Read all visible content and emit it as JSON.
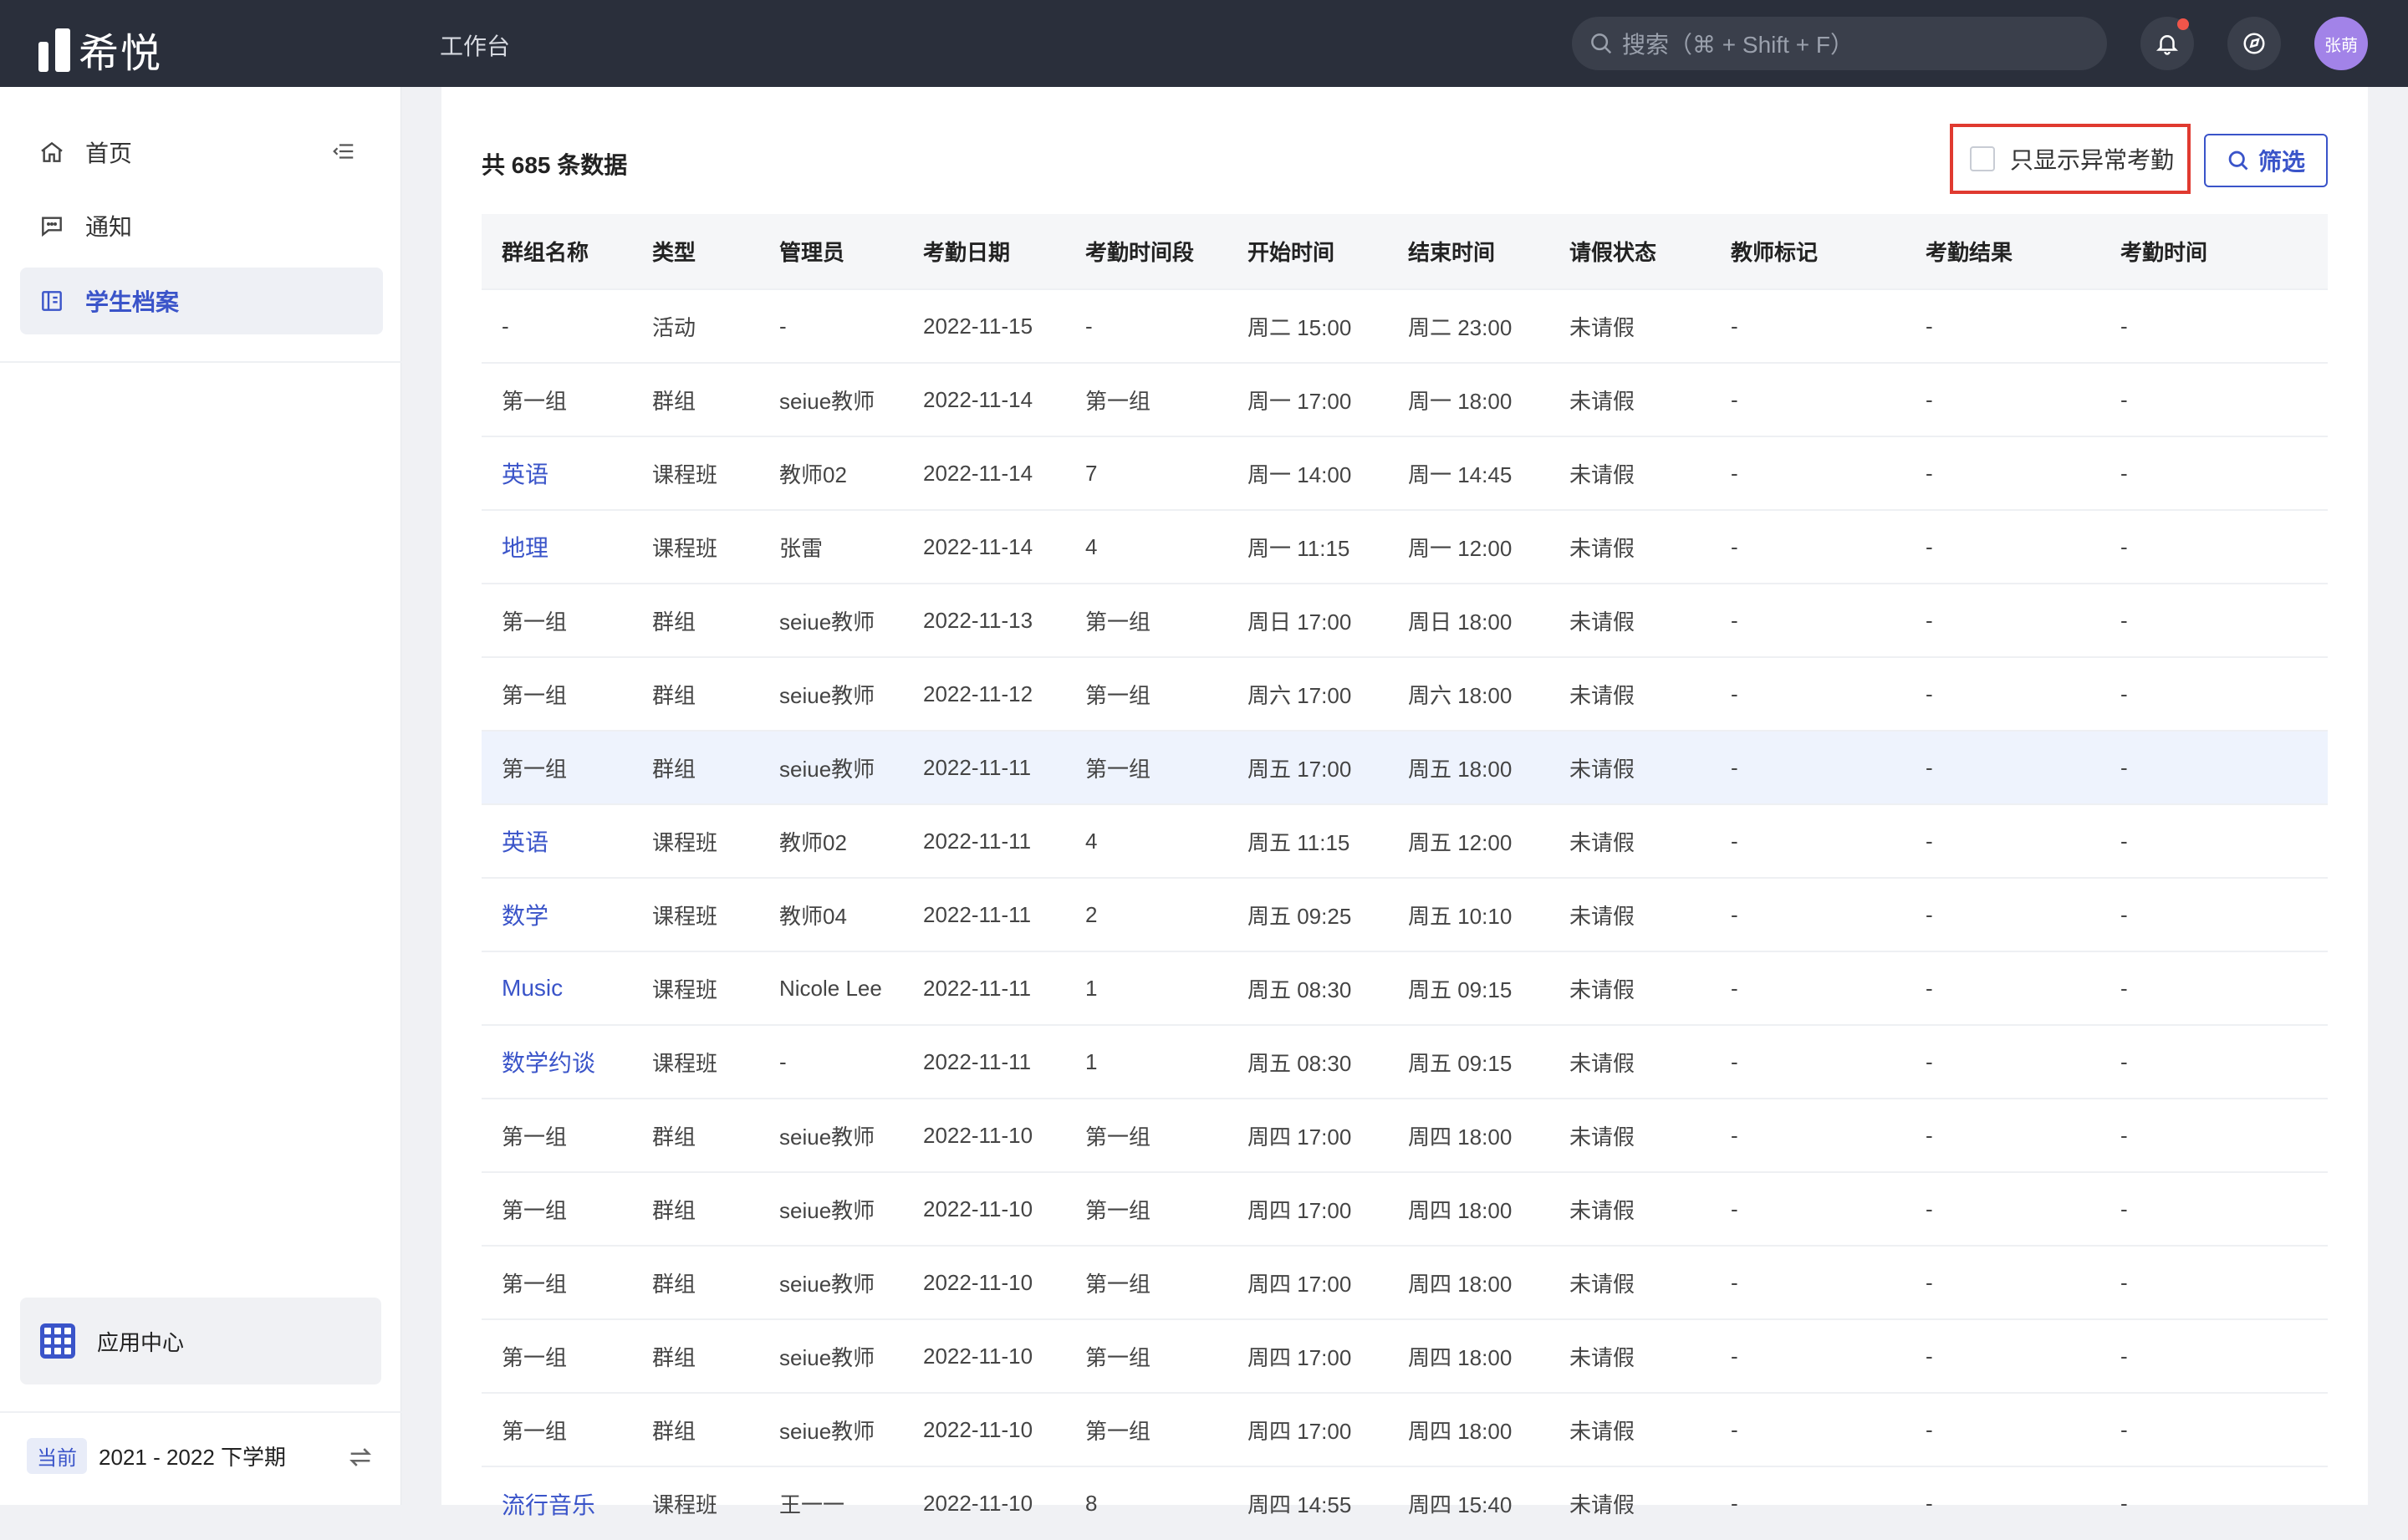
{
  "app": {
    "logo_text": "希悦",
    "workbench": "工作台"
  },
  "search": {
    "placeholder": "搜索（⌘ + Shift + F）"
  },
  "user": {
    "avatar_text": "张萌"
  },
  "sidebar": {
    "items": [
      {
        "label": "首页",
        "icon": "home-icon"
      },
      {
        "label": "通知",
        "icon": "message-icon"
      },
      {
        "label": "学生档案",
        "icon": "profile-icon"
      }
    ],
    "app_center": "应用中心",
    "term_badge": "当前",
    "term": "2021 - 2022 下学期"
  },
  "main": {
    "count": "共 685 条数据",
    "abnormal_only": "只显示异常考勤",
    "filter": "筛选",
    "columns": [
      "群组名称",
      "类型",
      "管理员",
      "考勤日期",
      "考勤时间段",
      "开始时间",
      "结束时间",
      "请假状态",
      "教师标记",
      "考勤结果",
      "考勤时间"
    ],
    "rows": [
      [
        "-",
        "活动",
        "-",
        "2022-11-15",
        "-",
        "周二 15:00",
        "周二 23:00",
        "未请假",
        "-",
        "-",
        "-"
      ],
      [
        "第一组",
        "群组",
        "seiue教师",
        "2022-11-14",
        "第一组",
        "周一 17:00",
        "周一 18:00",
        "未请假",
        "-",
        "-",
        "-"
      ],
      [
        "英语",
        "课程班",
        "教师02",
        "2022-11-14",
        "7",
        "周一 14:00",
        "周一 14:45",
        "未请假",
        "-",
        "-",
        "-"
      ],
      [
        "地理",
        "课程班",
        "张雷",
        "2022-11-14",
        "4",
        "周一 11:15",
        "周一 12:00",
        "未请假",
        "-",
        "-",
        "-"
      ],
      [
        "第一组",
        "群组",
        "seiue教师",
        "2022-11-13",
        "第一组",
        "周日 17:00",
        "周日 18:00",
        "未请假",
        "-",
        "-",
        "-"
      ],
      [
        "第一组",
        "群组",
        "seiue教师",
        "2022-11-12",
        "第一组",
        "周六 17:00",
        "周六 18:00",
        "未请假",
        "-",
        "-",
        "-"
      ],
      [
        "第一组",
        "群组",
        "seiue教师",
        "2022-11-11",
        "第一组",
        "周五 17:00",
        "周五 18:00",
        "未请假",
        "-",
        "-",
        "-"
      ],
      [
        "英语",
        "课程班",
        "教师02",
        "2022-11-11",
        "4",
        "周五 11:15",
        "周五 12:00",
        "未请假",
        "-",
        "-",
        "-"
      ],
      [
        "数学",
        "课程班",
        "教师04",
        "2022-11-11",
        "2",
        "周五 09:25",
        "周五 10:10",
        "未请假",
        "-",
        "-",
        "-"
      ],
      [
        "Music",
        "课程班",
        "Nicole Lee",
        "2022-11-11",
        "1",
        "周五 08:30",
        "周五 09:15",
        "未请假",
        "-",
        "-",
        "-"
      ],
      [
        "数学约谈",
        "课程班",
        "-",
        "2022-11-11",
        "1",
        "周五 08:30",
        "周五 09:15",
        "未请假",
        "-",
        "-",
        "-"
      ],
      [
        "第一组",
        "群组",
        "seiue教师",
        "2022-11-10",
        "第一组",
        "周四 17:00",
        "周四 18:00",
        "未请假",
        "-",
        "-",
        "-"
      ],
      [
        "第一组",
        "群组",
        "seiue教师",
        "2022-11-10",
        "第一组",
        "周四 17:00",
        "周四 18:00",
        "未请假",
        "-",
        "-",
        "-"
      ],
      [
        "第一组",
        "群组",
        "seiue教师",
        "2022-11-10",
        "第一组",
        "周四 17:00",
        "周四 18:00",
        "未请假",
        "-",
        "-",
        "-"
      ],
      [
        "第一组",
        "群组",
        "seiue教师",
        "2022-11-10",
        "第一组",
        "周四 17:00",
        "周四 18:00",
        "未请假",
        "-",
        "-",
        "-"
      ],
      [
        "第一组",
        "群组",
        "seiue教师",
        "2022-11-10",
        "第一组",
        "周四 17:00",
        "周四 18:00",
        "未请假",
        "-",
        "-",
        "-"
      ],
      [
        "流行音乐",
        "课程班",
        "王一一",
        "2022-11-10",
        "8",
        "周四 14:55",
        "周四 15:40",
        "未请假",
        "-",
        "-",
        "-"
      ]
    ],
    "link_rows": [
      2,
      3,
      7,
      8,
      9,
      10,
      16
    ],
    "highlight_row": 6
  },
  "colors": {
    "accent": "#3a54c9",
    "topbar": "#2a2f3b",
    "highlight_box": "#e03a30"
  }
}
